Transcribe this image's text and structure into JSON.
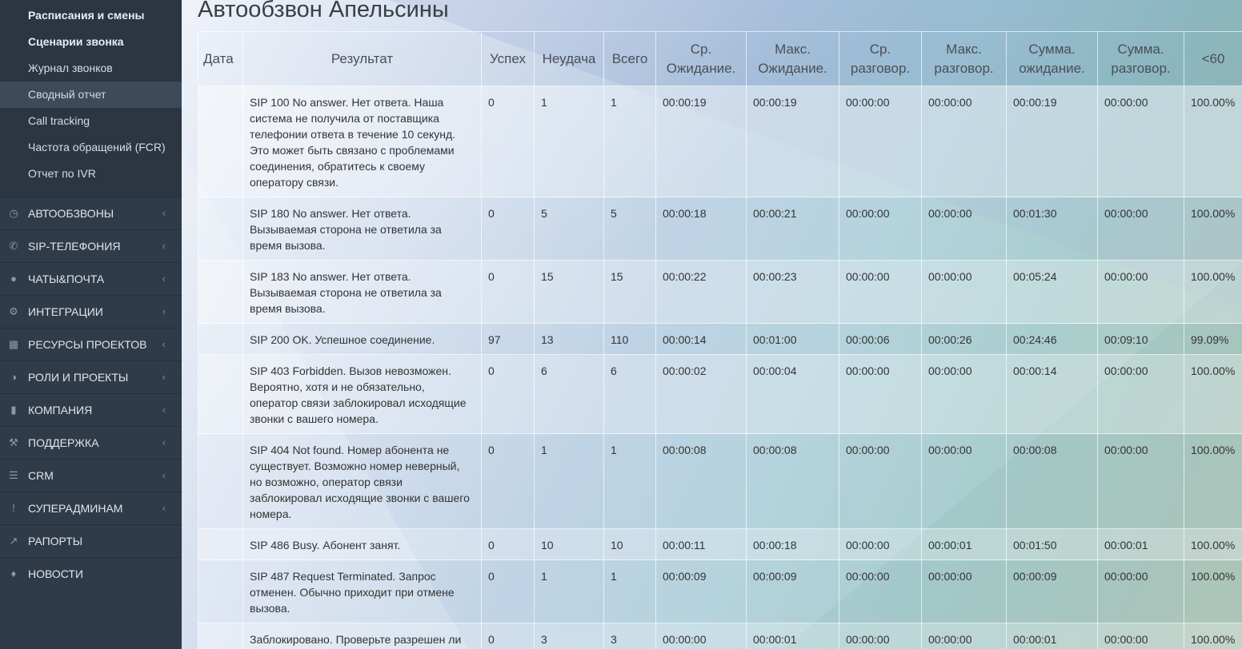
{
  "sidebar": {
    "subitems": [
      {
        "label": "Расписания и смены"
      },
      {
        "label": "Сценарии звонка"
      },
      {
        "label": "Журнал звонков"
      },
      {
        "label": "Сводный отчет"
      },
      {
        "label": "Call tracking"
      },
      {
        "label": "Частота обращений (FCR)"
      },
      {
        "label": "Отчет по IVR"
      }
    ],
    "items": [
      {
        "label": "АВТООБЗВОНЫ",
        "icon": "clock-icon"
      },
      {
        "label": "SIP-ТЕЛЕФОНИЯ",
        "icon": "phone-icon"
      },
      {
        "label": "ЧАТЫ&ПОЧТА",
        "icon": "chat-icon"
      },
      {
        "label": "ИНТЕГРАЦИИ",
        "icon": "gears-icon"
      },
      {
        "label": "РЕСУРСЫ ПРОЕКТОВ",
        "icon": "grid-icon"
      },
      {
        "label": "РОЛИ И ПРОЕКТЫ",
        "icon": "toggle-icon"
      },
      {
        "label": "КОМПАНИЯ",
        "icon": "bar-chart-icon"
      },
      {
        "label": "ПОДДЕРЖКА",
        "icon": "wrench-icon"
      },
      {
        "label": "CRM",
        "icon": "list-icon"
      },
      {
        "label": "СУПЕРАДМИНАМ",
        "icon": "exclamation-icon"
      },
      {
        "label": "РАПОРТЫ",
        "icon": "line-chart-icon"
      },
      {
        "label": "НОВОСТИ",
        "icon": "bell-icon"
      }
    ]
  },
  "page": {
    "title": "Автообзвон Апельсины"
  },
  "table": {
    "headers": [
      "Дата",
      "Результат",
      "Успех",
      "Неудача",
      "Всего",
      "Ср. Ожидание.",
      "Макс. Ожидание.",
      "Ср. разговор.",
      "Макс. разговор.",
      "Сумма. ожидание.",
      "Сумма. разговор.",
      "<60"
    ],
    "rows": [
      [
        "",
        "SIP 100 No answer. Нет ответа. Наша система не получила от поставщика телефонии ответа в течение 10 секунд. Это может быть связано с проблемами соединения, обратитесь к своему оператору связи.",
        "0",
        "1",
        "1",
        "00:00:19",
        "00:00:19",
        "00:00:00",
        "00:00:00",
        "00:00:19",
        "00:00:00",
        "100.00%"
      ],
      [
        "",
        "SIP 180 No answer. Нет ответа. Вызываемая сторона не ответила за время вызова.",
        "0",
        "5",
        "5",
        "00:00:18",
        "00:00:21",
        "00:00:00",
        "00:00:00",
        "00:01:30",
        "00:00:00",
        "100.00%"
      ],
      [
        "",
        "SIP 183 No answer. Нет ответа. Вызываемая сторона не ответила за время вызова.",
        "0",
        "15",
        "15",
        "00:00:22",
        "00:00:23",
        "00:00:00",
        "00:00:00",
        "00:05:24",
        "00:00:00",
        "100.00%"
      ],
      [
        "",
        "SIP 200 OK. Успешное соединение.",
        "97",
        "13",
        "110",
        "00:00:14",
        "00:01:00",
        "00:00:06",
        "00:00:26",
        "00:24:46",
        "00:09:10",
        "99.09%"
      ],
      [
        "",
        "SIP 403 Forbidden. Вызов невозможен. Вероятно, хотя и не обязательно, оператор связи заблокировал исходящие звонки с вашего номера.",
        "0",
        "6",
        "6",
        "00:00:02",
        "00:00:04",
        "00:00:00",
        "00:00:00",
        "00:00:14",
        "00:00:00",
        "100.00%"
      ],
      [
        "",
        "SIP 404 Not found. Номер абонента не существует. Возможно номер неверный, но возможно, оператор связи заблокировал исходящие звонки с вашего номера.",
        "0",
        "1",
        "1",
        "00:00:08",
        "00:00:08",
        "00:00:00",
        "00:00:00",
        "00:00:08",
        "00:00:00",
        "100.00%"
      ],
      [
        "",
        "SIP 486 Busy. Абонент занят.",
        "0",
        "10",
        "10",
        "00:00:11",
        "00:00:18",
        "00:00:00",
        "00:00:01",
        "00:01:50",
        "00:00:01",
        "100.00%"
      ],
      [
        "",
        "SIP 487 Request Terminated. Запрос отменен. Обычно приходит при отмене вызова.",
        "0",
        "1",
        "1",
        "00:00:09",
        "00:00:09",
        "00:00:00",
        "00:00:00",
        "00:00:09",
        "00:00:00",
        "100.00%"
      ],
      [
        "",
        "Заблокировано. Проверьте разрешен ли префикс поставщика, возможно",
        "0",
        "3",
        "3",
        "00:00:00",
        "00:00:01",
        "00:00:00",
        "00:00:00",
        "00:00:01",
        "00:00:00",
        "100.00%"
      ]
    ]
  }
}
